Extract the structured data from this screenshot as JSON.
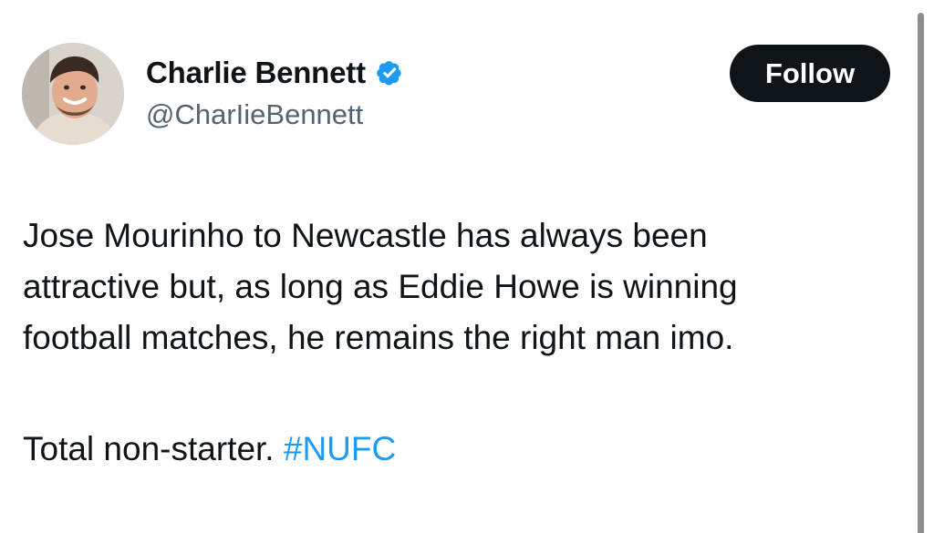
{
  "author": {
    "display_name": "Charlie Bennett",
    "handle": "@CharIieBennett",
    "verified": true,
    "verified_icon": "verified-badge-icon"
  },
  "follow_button": {
    "label": "Follow"
  },
  "tweet": {
    "lines": [
      "Jose Mourinho to Newcastle has always been",
      "attractive but, as long as Eddie Howe is winning",
      "football matches, he remains the right man imo."
    ],
    "second_paragraph_text": "Total non-starter.",
    "hashtag": "#NUFC"
  },
  "colors": {
    "text": "#0f1419",
    "secondary_text": "#536471",
    "link": "#1d9bf0",
    "verified_badge": "#1d9bf0",
    "button_bg": "#0f1419",
    "button_text": "#ffffff"
  }
}
